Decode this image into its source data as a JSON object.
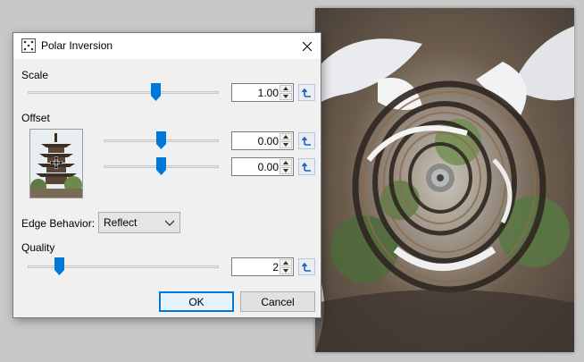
{
  "dialog": {
    "title": "Polar Inversion",
    "scale": {
      "label": "Scale",
      "value": "1.00",
      "slider_position": 0.68
    },
    "offset": {
      "label": "Offset",
      "x": {
        "value": "0.00",
        "slider_position": 0.5
      },
      "y": {
        "value": "0.00",
        "slider_position": 0.5
      }
    },
    "edge_behavior": {
      "label": "Edge Behavior:",
      "selected": "Reflect"
    },
    "quality": {
      "label": "Quality",
      "value": "2",
      "slider_position": 0.15
    },
    "ok_label": "OK",
    "cancel_label": "Cancel"
  },
  "colors": {
    "accent": "#0078d7",
    "dialog_bg": "#f0f0f0",
    "desktop_bg": "#c8c8c8"
  },
  "icons": {
    "app": "polar-inversion-icon",
    "close": "close-icon",
    "reset": "reset-arrow-icon",
    "move": "move-crosshair-icon"
  }
}
